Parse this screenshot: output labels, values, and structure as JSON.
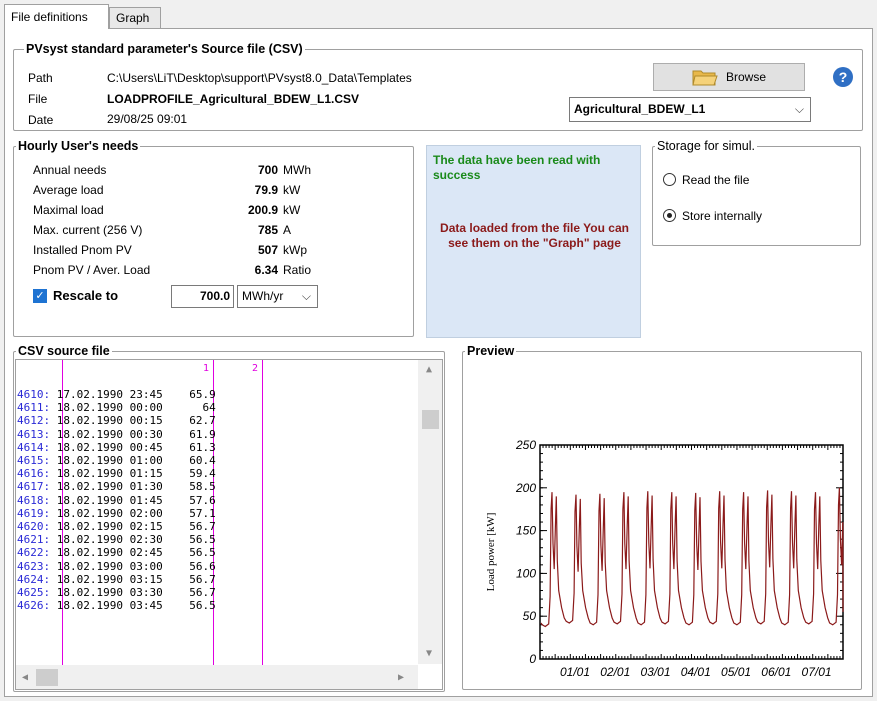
{
  "tabs": [
    {
      "label": "File definitions",
      "active": true
    },
    {
      "label": "Graph",
      "active": false
    }
  ],
  "source": {
    "title": "PVsyst standard parameter's Source file (CSV)",
    "path_label": "Path",
    "path_value": "C:\\Users\\LiT\\Desktop\\support\\PVsyst8.0_Data\\Templates",
    "file_label": "File",
    "file_value": "LOADPROFILE_Agricultural_BDEW_L1.CSV",
    "date_label": "Date",
    "date_value": "29/08/25 09:01",
    "browse_label": "Browse",
    "help_label": "?",
    "profile_selected": "Agricultural_BDEW_L1"
  },
  "needs": {
    "title": "Hourly User's needs",
    "rows": [
      {
        "label": "Annual needs",
        "value": "700",
        "unit": "MWh"
      },
      {
        "label": "Average load",
        "value": "79.9",
        "unit": "kW"
      },
      {
        "label": "Maximal load",
        "value": "200.9",
        "unit": "kW"
      },
      {
        "label": "Max. current (256 V)",
        "value": "785",
        "unit": "A"
      },
      {
        "label": "Installed Pnom PV",
        "value": "507",
        "unit": "kWp"
      },
      {
        "label": "Pnom PV / Aver. Load",
        "value": "6.34",
        "unit": "Ratio"
      }
    ],
    "rescale_label": "Rescale to",
    "rescale_checked": true,
    "rescale_value": "700.0",
    "rescale_unit": "MWh/yr"
  },
  "status": {
    "success": "The data have been read with success",
    "loaded": "Data loaded from the file You can see them on the \"Graph\" page",
    "success_color": "#1a8a1a",
    "loaded_color": "#8b1a1a"
  },
  "storage": {
    "title": "Storage for simul.",
    "options": [
      {
        "label": "Read the file",
        "selected": false
      },
      {
        "label": "Store internally",
        "selected": true
      }
    ]
  },
  "csv": {
    "title": "CSV source file",
    "col_headers": [
      "1",
      "2"
    ],
    "rows": [
      {
        "ln": "4610:",
        "date": "17.02.1990",
        "time": "23:45",
        "val": "65.9"
      },
      {
        "ln": "4611:",
        "date": "18.02.1990",
        "time": "00:00",
        "val": "64"
      },
      {
        "ln": "4612:",
        "date": "18.02.1990",
        "time": "00:15",
        "val": "62.7"
      },
      {
        "ln": "4613:",
        "date": "18.02.1990",
        "time": "00:30",
        "val": "61.9"
      },
      {
        "ln": "4614:",
        "date": "18.02.1990",
        "time": "00:45",
        "val": "61.3"
      },
      {
        "ln": "4615:",
        "date": "18.02.1990",
        "time": "01:00",
        "val": "60.4"
      },
      {
        "ln": "4616:",
        "date": "18.02.1990",
        "time": "01:15",
        "val": "59.4"
      },
      {
        "ln": "4617:",
        "date": "18.02.1990",
        "time": "01:30",
        "val": "58.5"
      },
      {
        "ln": "4618:",
        "date": "18.02.1990",
        "time": "01:45",
        "val": "57.6"
      },
      {
        "ln": "4619:",
        "date": "18.02.1990",
        "time": "02:00",
        "val": "57.1"
      },
      {
        "ln": "4620:",
        "date": "18.02.1990",
        "time": "02:15",
        "val": "56.7"
      },
      {
        "ln": "4621:",
        "date": "18.02.1990",
        "time": "02:30",
        "val": "56.5"
      },
      {
        "ln": "4622:",
        "date": "18.02.1990",
        "time": "02:45",
        "val": "56.5"
      },
      {
        "ln": "4623:",
        "date": "18.02.1990",
        "time": "03:00",
        "val": "56.6"
      },
      {
        "ln": "4624:",
        "date": "18.02.1990",
        "time": "03:15",
        "val": "56.7"
      },
      {
        "ln": "4625:",
        "date": "18.02.1990",
        "time": "03:30",
        "val": "56.7"
      },
      {
        "ln": "4626:",
        "date": "18.02.1990",
        "time": "03:45",
        "val": "56.5"
      }
    ]
  },
  "preview": {
    "title": "Preview",
    "chart_data": {
      "type": "line",
      "ylabel": "Load power [kW]",
      "ylim": [
        0,
        250
      ],
      "yticks": [
        "0",
        "50",
        "100",
        "150",
        "200",
        "250"
      ],
      "xticks": [
        "01/01",
        "02/01",
        "03/01",
        "04/01",
        "05/01",
        "06/01",
        "07/01"
      ],
      "line_color": "#8b1a1a",
      "x": [
        "12/31",
        "01/01",
        "01/02",
        "01/03",
        "01/04",
        "01/05",
        "01/06",
        "01/07",
        "01/08",
        "01/09",
        "01/10",
        "01/11",
        "01/12",
        "01/13"
      ],
      "peaks": [
        195,
        192,
        193,
        195,
        196,
        195,
        194,
        196,
        195,
        197,
        196,
        195,
        200
      ],
      "troughs": [
        38,
        42,
        40,
        41,
        40,
        41,
        40,
        41,
        40,
        41,
        40,
        41,
        40
      ]
    }
  }
}
